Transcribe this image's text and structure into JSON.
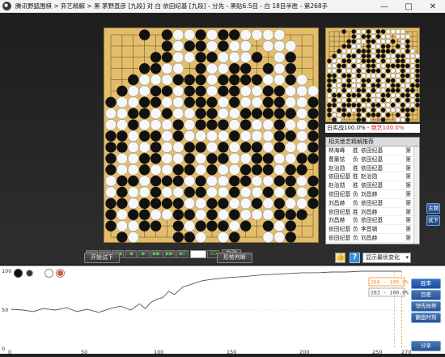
{
  "window": {
    "title": "腾讯野狐围棋 > 弈艺精解 > 黑 茅野直彦 [九段] 对 白 依田纪基 [九段] - 分先 - 黑贴6.5目 - 白 18目半胜 - 第268手",
    "minimize": "—",
    "maximize": "□",
    "close": "✕"
  },
  "mini": {
    "score_label": "白实战100.0%",
    "score_sep": " - ",
    "ai_label": "绝艺100.0%"
  },
  "recommend": {
    "title": "相关绝艺精解推荐",
    "rows": [
      {
        "a": "林海峰",
        "r": "胜",
        "b": "依田纪基",
        "m": "第"
      },
      {
        "a": "曹薰铉",
        "r": "负",
        "b": "依田纪基",
        "m": "第"
      },
      {
        "a": "赵治勋",
        "r": "胜",
        "b": "依田纪基",
        "m": "第"
      },
      {
        "a": "依田纪基",
        "r": "胜",
        "b": "赵治勋",
        "m": "第"
      },
      {
        "a": "赵治勋",
        "r": "胜",
        "b": "依田纪基",
        "m": "第"
      },
      {
        "a": "依田纪基",
        "r": "负",
        "b": "刘昌赫",
        "m": "第"
      },
      {
        "a": "刘昌赫",
        "r": "负",
        "b": "依田纪基",
        "m": "第"
      },
      {
        "a": "依田纪基",
        "r": "胜",
        "b": "刘昌赫",
        "m": "第"
      },
      {
        "a": "刘昌赫",
        "r": "负",
        "b": "依田纪基",
        "m": "第"
      },
      {
        "a": "依田纪基",
        "r": "负",
        "b": "李昌镐",
        "m": "第"
      },
      {
        "a": "依田纪基",
        "r": "负",
        "b": "刘昌赫",
        "m": "第"
      }
    ]
  },
  "side": {
    "btn1": "主题",
    "btn2": "试下"
  },
  "nav": {
    "auto": "自动",
    "first": "|◀",
    "prev10": "◀◀",
    "prev": "◀",
    "next": "▶",
    "next10": "▶▶",
    "last": "▶|",
    "go": "GO"
  },
  "toolbar": {
    "try_move": "开始试下",
    "judge": "形势判断",
    "select_label": "显示最优变化",
    "select_arrow": "▾",
    "help": "?"
  },
  "graph": {
    "buttons": [
      "胜率",
      "目差",
      "领先局势",
      "翻盘时刻",
      "分享"
    ],
    "tag1": "268 - 100.0%",
    "tag2": "263 - 100.0%",
    "y_labels": [
      "100",
      "50",
      "0"
    ],
    "x_labels": [
      "0",
      "50",
      "100",
      "150",
      "200",
      "250",
      "270"
    ]
  },
  "colors": {
    "accent": "#2a5290",
    "red": "#e02020",
    "orange": "#f28c1e",
    "board": "#e3bd6a"
  },
  "icons": {
    "thumb": "thumb-up-icon",
    "help": "help-icon"
  }
}
